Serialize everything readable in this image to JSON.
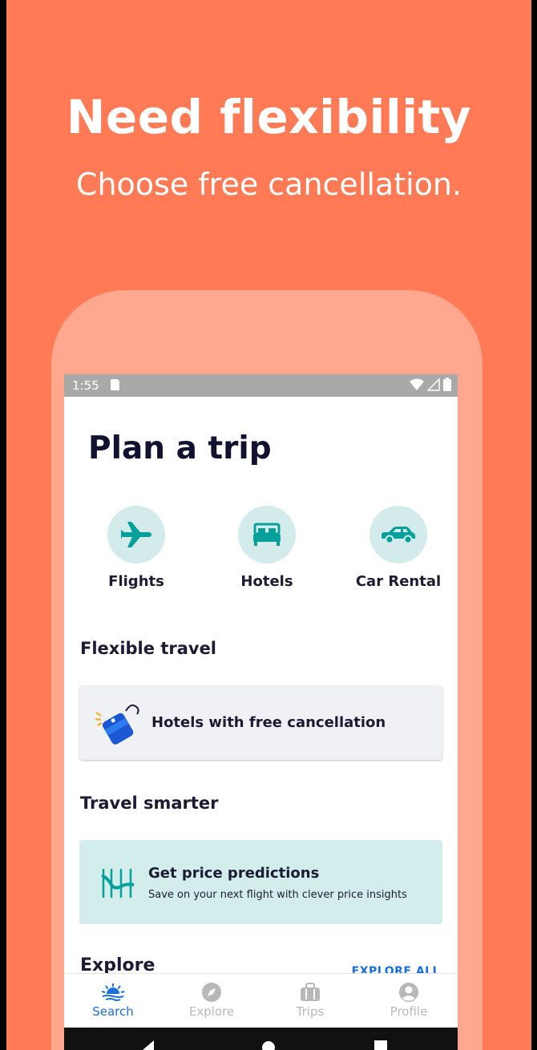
{
  "promo": {
    "headline": "Need flexibility",
    "subline": "Choose free cancellation."
  },
  "statusbar": {
    "time": "1:55"
  },
  "page": {
    "title": "Plan a trip"
  },
  "categories": [
    {
      "label": "Flights",
      "icon": "airplane-icon"
    },
    {
      "label": "Hotels",
      "icon": "bed-icon"
    },
    {
      "label": "Car Rental",
      "icon": "car-icon"
    }
  ],
  "flexible_travel": {
    "heading": "Flexible travel",
    "card_label": "Hotels with free cancellation"
  },
  "travel_smarter": {
    "heading": "Travel smarter",
    "card_title": "Get price predictions",
    "card_subtitle": "Save on your next flight with clever price insights"
  },
  "explore": {
    "heading": "Explore",
    "link": "EXPLORE ALL"
  },
  "bottom_nav": [
    {
      "label": "Search",
      "icon": "search-sun-icon",
      "active": true
    },
    {
      "label": "Explore",
      "icon": "compass-icon",
      "active": false
    },
    {
      "label": "Trips",
      "icon": "briefcase-icon",
      "active": false
    },
    {
      "label": "Profile",
      "icon": "person-icon",
      "active": false
    }
  ],
  "colors": {
    "background": "#ff7a55",
    "phone_frame": "#ffa88f",
    "accent": "#1b6fd6",
    "teal": "#05a09a",
    "icon_circle": "#d3ebea"
  }
}
